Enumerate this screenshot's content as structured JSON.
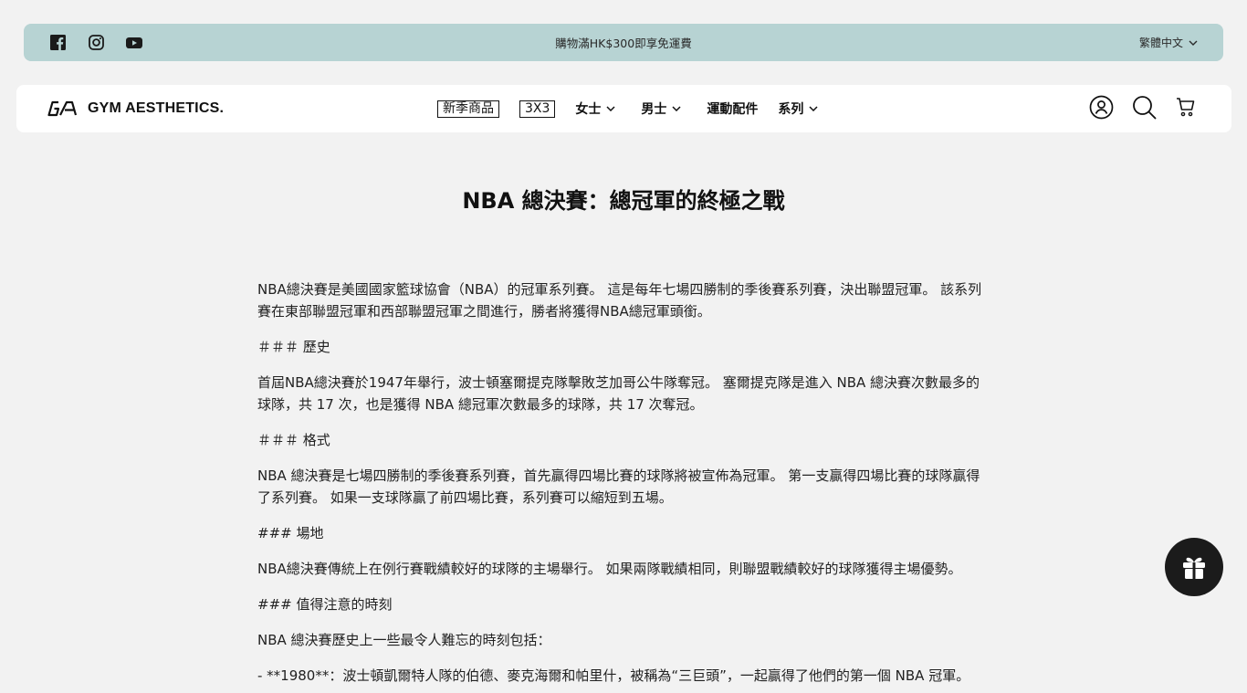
{
  "announcement": {
    "text": "購物滿HK$300即享免運費",
    "language": "繁體中文",
    "social_icons": [
      "facebook-icon",
      "instagram-icon",
      "youtube-icon"
    ]
  },
  "header": {
    "logo_text": "GYM AESTHETICS.",
    "nav": [
      {
        "label": "新季商品",
        "boxed": true
      },
      {
        "label": "3X3",
        "boxed": true
      },
      {
        "label": "女士",
        "dropdown": true
      },
      {
        "label": "男士",
        "dropdown": true
      },
      {
        "label": "運動配件",
        "dropdown": false
      },
      {
        "label": "系列",
        "dropdown": true
      }
    ],
    "icons": [
      "account-icon",
      "search-icon",
      "cart-icon"
    ]
  },
  "article": {
    "title": "NBA 總決賽：總冠軍的終極之戰",
    "paragraphs": [
      "NBA總決賽是美國國家籃球協會（NBA）的冠軍系列賽。 這是每年七場四勝制的季後賽系列賽，決出聯盟冠軍。 該系列賽在東部聯盟冠軍和西部聯盟冠軍之間進行，勝者將獲得NBA總冠軍頭銜。",
      "＃＃＃ 歷史",
      "首屆NBA總決賽於1947年舉行，波士頓塞爾提克隊擊敗芝加哥公牛隊奪冠。 塞爾提克隊是進入 NBA 總決賽次數最多的球隊，共 17 次，也是獲得 NBA 總冠軍次數最多的球隊，共 17 次奪冠。",
      "＃＃＃ 格式",
      "NBA 總決賽是七場四勝制的季後賽系列賽，首先贏得四場比賽的球隊將被宣佈為冠軍。 第一支贏得四場比賽的球隊贏得了系列賽。 如果一支球隊贏了前四場比賽，系列賽可以縮短到五場。",
      "### 場地",
      "NBA總決賽傳統上在例行賽戰績較好的球隊的主場舉行。 如果兩隊戰績相同，則聯盟戰績較好的球隊獲得主場優勢。",
      "### 值得注意的時刻",
      "NBA 總決賽歷史上一些最令人難忘的時刻包括：",
      "- **1980**：波士頓凱爾特人隊的伯德、麥克海爾和帕里什，被稱為“三巨頭”，一起贏得了他們的第一個 NBA 冠軍。"
    ]
  },
  "floating": {
    "icon": "gift-icon"
  }
}
